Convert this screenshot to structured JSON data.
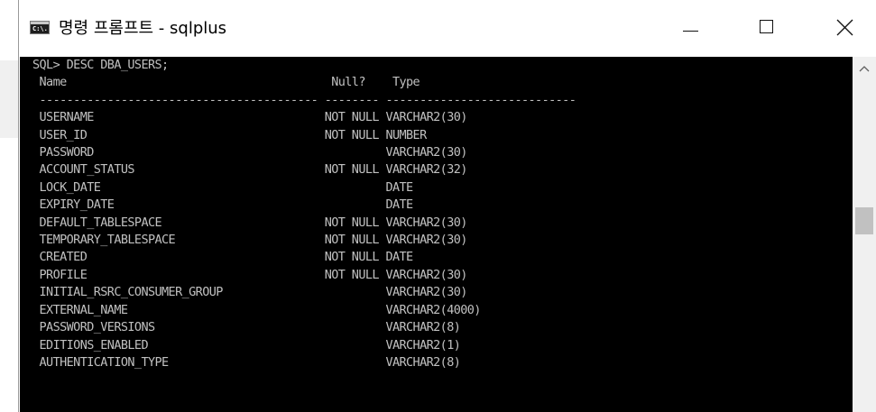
{
  "window": {
    "title": "명령 프롬프트 - sqlplus",
    "icon_text": "C:\\."
  },
  "console": {
    "lines": [
      "SQL> DESC DBA_USERS;",
      " Name                                       Null?    Type",
      " ----------------------------------------- -------- ----------------------------",
      " USERNAME                                  NOT NULL VARCHAR2(30)",
      " USER_ID                                   NOT NULL NUMBER",
      " PASSWORD                                           VARCHAR2(30)",
      " ACCOUNT_STATUS                            NOT NULL VARCHAR2(32)",
      " LOCK_DATE                                          DATE",
      " EXPIRY_DATE                                        DATE",
      " DEFAULT_TABLESPACE                        NOT NULL VARCHAR2(30)",
      " TEMPORARY_TABLESPACE                      NOT NULL VARCHAR2(30)",
      " CREATED                                   NOT NULL DATE",
      " PROFILE                                   NOT NULL VARCHAR2(30)",
      " INITIAL_RSRC_CONSUMER_GROUP                        VARCHAR2(30)",
      " EXTERNAL_NAME                                      VARCHAR2(4000)",
      " PASSWORD_VERSIONS                                  VARCHAR2(8)",
      " EDITIONS_ENABLED                                   VARCHAR2(1)",
      " AUTHENTICATION_TYPE                                VARCHAR2(8)"
    ]
  },
  "icons": {
    "app": "command-prompt-icon",
    "minimize": "minimize-icon",
    "maximize": "maximize-icon",
    "close": "close-icon",
    "scroll_up": "scroll-up-arrow-icon"
  },
  "colors": {
    "console_bg": "#000000",
    "console_fg": "#c0c0c0",
    "titlebar_bg": "#ffffff",
    "scrollbar_bg": "#f0f0f0"
  }
}
